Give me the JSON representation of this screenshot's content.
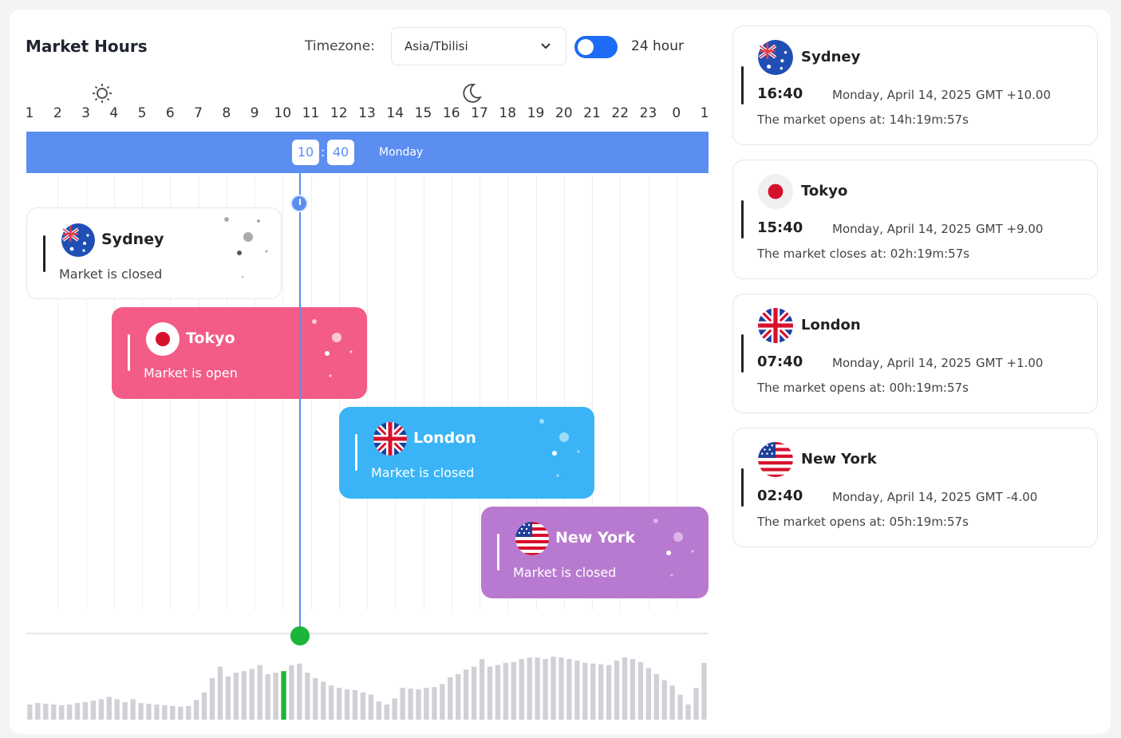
{
  "header": {
    "title": "Market Hours",
    "timezone_label": "Timezone:",
    "timezone_value": "Asia/Tbilisi",
    "toggle_label": "24 hour",
    "toggle_on": true
  },
  "timeline": {
    "hours": [
      "1",
      "2",
      "3",
      "4",
      "5",
      "6",
      "7",
      "8",
      "9",
      "10",
      "11",
      "12",
      "13",
      "14",
      "15",
      "16",
      "17",
      "18",
      "19",
      "20",
      "21",
      "22",
      "23",
      "0",
      "1"
    ],
    "current_hour": "10",
    "current_minute": "40",
    "current_day": "Monday",
    "band_color": "#5b8ef0"
  },
  "sessions": [
    {
      "city": "Sydney",
      "status": "Market is closed",
      "color": "#ffffff"
    },
    {
      "city": "Tokyo",
      "status": "Market is open",
      "color": "#f25c87"
    },
    {
      "city": "London",
      "status": "Market is closed",
      "color": "#3ab4f7"
    },
    {
      "city": "New York",
      "status": "Market is closed",
      "color": "#b87ad0"
    }
  ],
  "markets": [
    {
      "city": "Sydney",
      "time": "16:40",
      "date": "Monday, April 14, 2025",
      "gmt": "GMT +10.00",
      "note": "The market opens at: 14h:19m:57s",
      "flag": "australia-flag-icon"
    },
    {
      "city": "Tokyo",
      "time": "15:40",
      "date": "Monday, April 14, 2025",
      "gmt": "GMT +9.00",
      "note": "The market closes at: 02h:19m:57s",
      "flag": "japan-flag-icon"
    },
    {
      "city": "London",
      "time": "07:40",
      "date": "Monday, April 14, 2025",
      "gmt": "GMT +1.00",
      "note": "The market opens at: 00h:19m:57s",
      "flag": "uk-flag-icon"
    },
    {
      "city": "New York",
      "time": "02:40",
      "date": "Monday, April 14, 2025",
      "gmt": "GMT -4.00",
      "note": "The market opens at: 05h:19m:57s",
      "flag": "us-flag-icon"
    }
  ],
  "volume": {
    "values": [
      20,
      22,
      21,
      20,
      19,
      20,
      22,
      23,
      25,
      27,
      30,
      27,
      23,
      27,
      22,
      21,
      20,
      19,
      18,
      17,
      18,
      26,
      36,
      55,
      70,
      57,
      62,
      64,
      67,
      72,
      60,
      62,
      64,
      72,
      74,
      62,
      55,
      50,
      45,
      42,
      40,
      39,
      36,
      33,
      24,
      20,
      28,
      42,
      41,
      40,
      42,
      43,
      47,
      56,
      60,
      66,
      70,
      80,
      70,
      72,
      75,
      76,
      80,
      82,
      82,
      80,
      83,
      82,
      80,
      78,
      75,
      74,
      73,
      72,
      78,
      82,
      80,
      76,
      68,
      60,
      52,
      45,
      33,
      20,
      42,
      75
    ],
    "highlight_index": 32,
    "bar_color": "#cfd1d6",
    "highlight_color": "#1db43a"
  }
}
